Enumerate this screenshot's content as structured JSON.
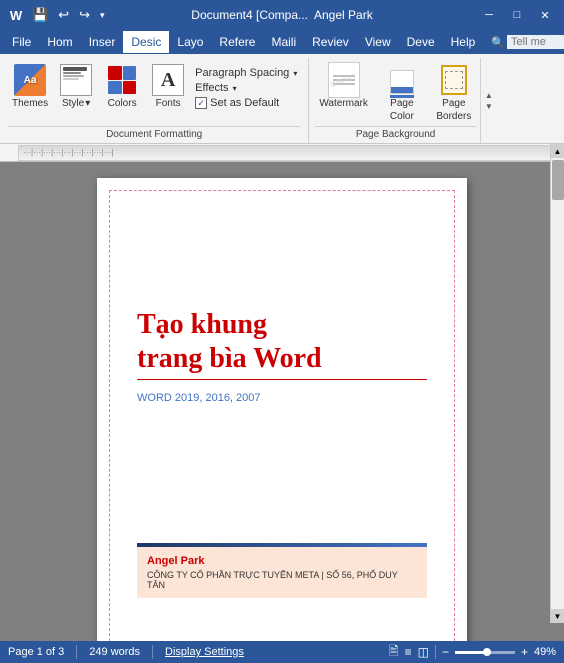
{
  "titlebar": {
    "doc_title": "Document4 [Compa...",
    "user_name": "Angel Park",
    "minimize": "─",
    "maximize": "□",
    "close": "✕"
  },
  "quickaccess": {
    "save": "💾",
    "undo": "↩",
    "redo": "↪",
    "customize": "▾"
  },
  "menubar": {
    "items": [
      "File",
      "Hom",
      "Inser",
      "Desic",
      "Layo",
      "Refere",
      "Mailing",
      "Reviev",
      "View",
      "Deve",
      "Help"
    ]
  },
  "ribbon": {
    "active_tab": "Desic",
    "groups": [
      {
        "label": "Document Formatting",
        "items": [
          {
            "id": "themes",
            "label": "Themes",
            "icon_type": "themes"
          },
          {
            "id": "style-set",
            "label": "Style\nSet",
            "icon_type": "styleset"
          },
          {
            "id": "colors",
            "label": "Colors",
            "icon_type": "colors"
          },
          {
            "id": "fonts",
            "label": "Fonts",
            "icon_type": "fonts"
          }
        ],
        "small_items": [
          {
            "id": "paragraph-spacing",
            "label": "Paragraph Spacing",
            "has_arrow": true
          },
          {
            "id": "effects",
            "label": "Effects",
            "has_arrow": true,
            "checked": false
          },
          {
            "id": "set-as-default",
            "label": "Set as Default",
            "is_check": true,
            "checked": true
          }
        ]
      },
      {
        "label": "Page Background",
        "items": [
          {
            "id": "watermark",
            "label": "Watermark",
            "icon_type": "watermark"
          },
          {
            "id": "page-color",
            "label": "Page\nColor",
            "icon_type": "pagecolor"
          },
          {
            "id": "page-borders",
            "label": "Page\nBorders",
            "icon_type": "pageborders"
          }
        ]
      }
    ]
  },
  "document": {
    "title": "Tạo khung\ntrang bìa Word",
    "subtitle": "WORD 2019, 2016, 2007",
    "footer_name": "Angel Park",
    "footer_company": "CÔNG TY CỔ PHẦN TRỰC TUYẾN META | SỐ 56, PHỐ DUY TÂN"
  },
  "statusbar": {
    "page_info": "Page 1 of 3",
    "word_count": "249 words",
    "display_settings": "Display Settings",
    "zoom_level": "49%",
    "view_icons": [
      "🖹",
      "≡",
      "◫"
    ]
  }
}
